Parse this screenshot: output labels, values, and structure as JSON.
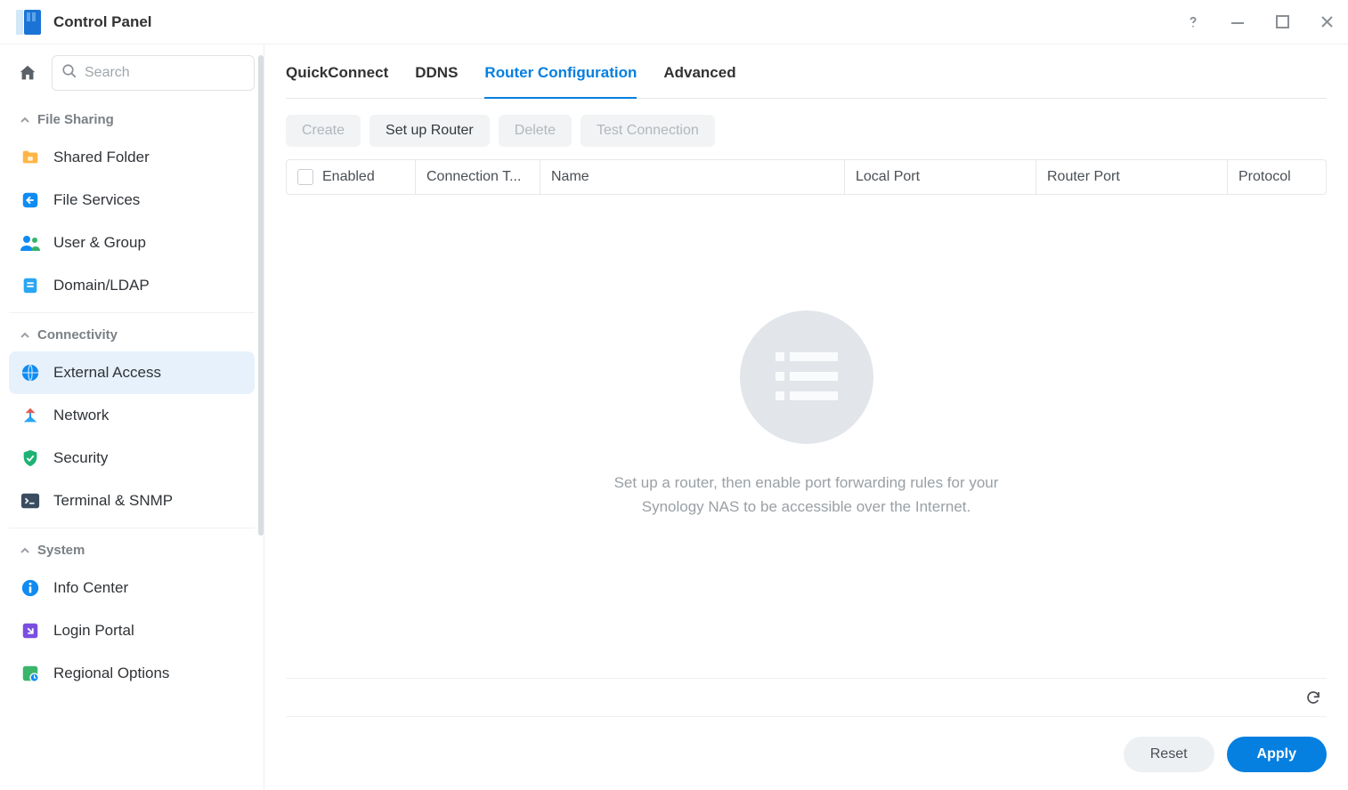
{
  "window": {
    "title": "Control Panel"
  },
  "search": {
    "placeholder": "Search"
  },
  "sections": [
    {
      "name": "File Sharing",
      "items": [
        "Shared Folder",
        "File Services",
        "User & Group",
        "Domain/LDAP"
      ]
    },
    {
      "name": "Connectivity",
      "items": [
        "External Access",
        "Network",
        "Security",
        "Terminal & SNMP"
      ]
    },
    {
      "name": "System",
      "items": [
        "Info Center",
        "Login Portal",
        "Regional Options"
      ]
    }
  ],
  "active_nav": "External Access",
  "tabs": [
    "QuickConnect",
    "DDNS",
    "Router Configuration",
    "Advanced"
  ],
  "active_tab": "Router Configuration",
  "toolbar": {
    "create": "Create",
    "setup": "Set up Router",
    "delete": "Delete",
    "test": "Test Connection"
  },
  "columns": {
    "enabled": "Enabled",
    "connection_type": "Connection T...",
    "name": "Name",
    "local_port": "Local Port",
    "router_port": "Router Port",
    "protocol": "Protocol"
  },
  "empty_message": "Set up a router, then enable port forwarding rules for your Synology NAS to be accessible over the Internet.",
  "actions": {
    "reset": "Reset",
    "apply": "Apply"
  },
  "colors": {
    "accent": "#057fe0"
  }
}
